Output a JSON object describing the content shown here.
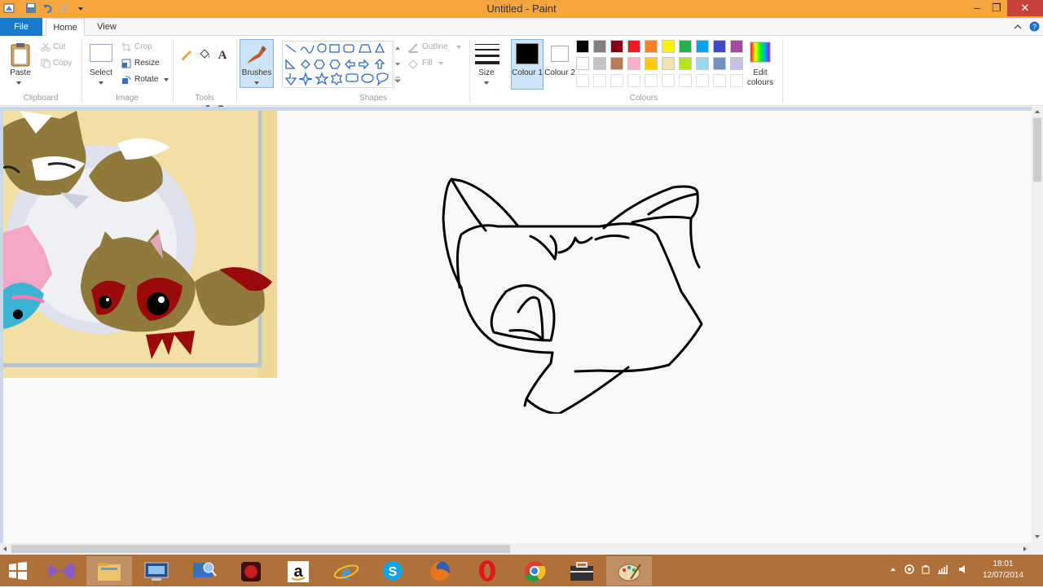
{
  "window": {
    "title": "Untitled - Paint"
  },
  "tabs": {
    "file": "File",
    "home": "Home",
    "view": "View"
  },
  "clipboard": {
    "paste": "Paste",
    "cut": "Cut",
    "copy": "Copy",
    "group": "Clipboard"
  },
  "image": {
    "select": "Select",
    "crop": "Crop",
    "resize": "Resize",
    "rotate": "Rotate",
    "group": "Image"
  },
  "tools": {
    "group": "Tools"
  },
  "brushes": {
    "label": "Brushes"
  },
  "shapes": {
    "group": "Shapes",
    "outline": "Outline",
    "fill": "Fill"
  },
  "size": {
    "label": "Size"
  },
  "colours": {
    "colour1": "Colour 1",
    "colour2": "Colour 2",
    "edit": "Edit colours",
    "group": "Colours",
    "palette_row1": [
      "#000000",
      "#7f7f7f",
      "#880015",
      "#ed1c24",
      "#ff7f27",
      "#fff200",
      "#22b14c",
      "#00a2e8",
      "#3f48cc",
      "#a349a4"
    ],
    "palette_row2": [
      "#ffffff",
      "#c3c3c3",
      "#b97a57",
      "#ffaec9",
      "#ffc90e",
      "#efe4b0",
      "#b5e61d",
      "#99d9ea",
      "#7092be",
      "#c8bfe7"
    ]
  },
  "taskbar": {
    "icons": [
      "start-icon",
      "visual-studio-icon",
      "file-explorer-icon",
      "remote-desktop-icon",
      "network-icon",
      "game-icon",
      "amazon-icon",
      "internet-explorer-icon",
      "skype-icon",
      "firefox-icon",
      "opera-icon",
      "chrome-icon",
      "toolbox-icon",
      "paint-icon"
    ],
    "time": "18:01",
    "date": "12/07/2014"
  }
}
